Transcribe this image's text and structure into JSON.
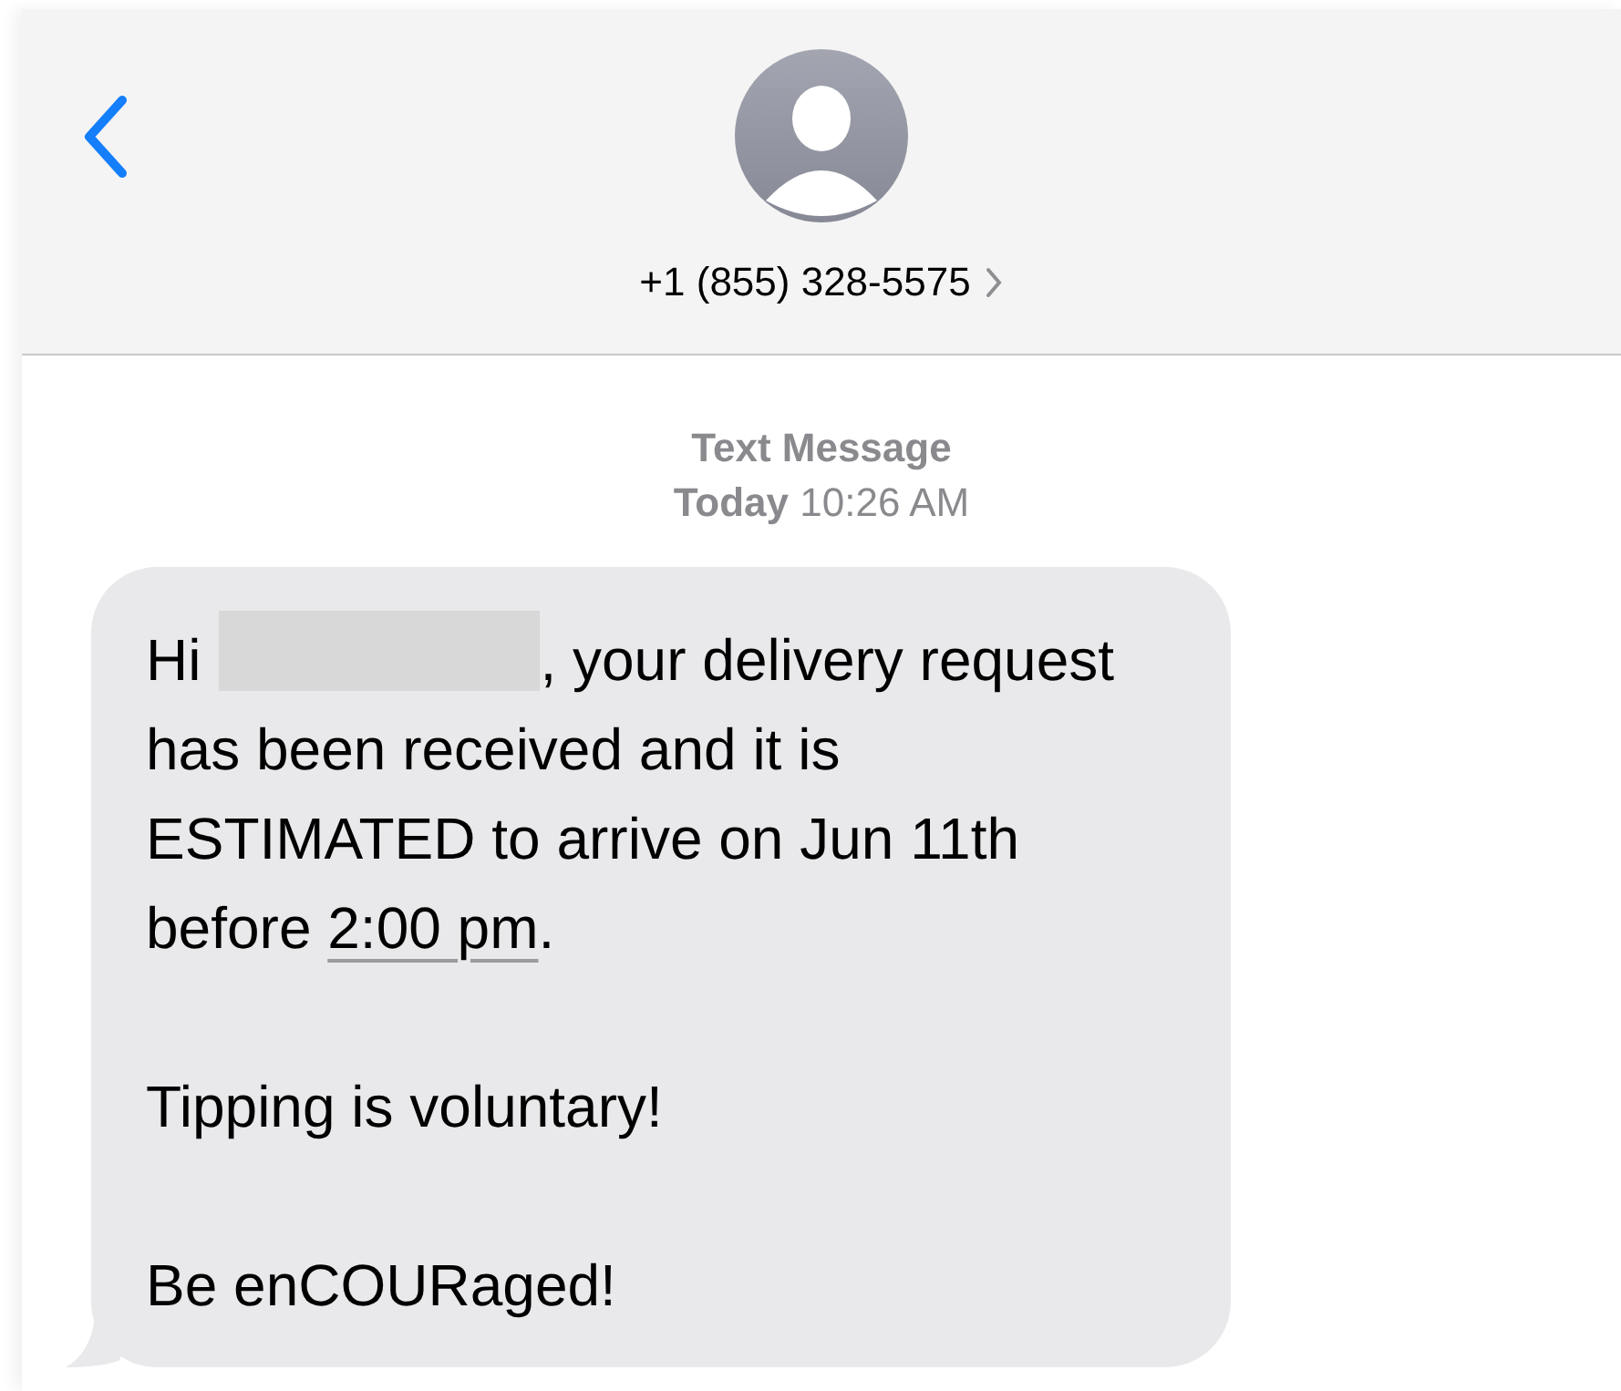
{
  "header": {
    "contact": "+1 (855) 328-5575"
  },
  "timestamp": {
    "label": "Text Message",
    "time": "**Today** 10:26 AM"
  },
  "message": {
    "greeting": "Hi",
    "name_redacted": true,
    "text": ", your delivery request has been received and it is ESTIMATED to arrive on Jun 11th before ",
    "link": "2:00 pm",
    "end": ".",
    "paragraphs": [
      "Tipping is voluntary!",
      "Be enCOURaged!"
    ]
  }
}
